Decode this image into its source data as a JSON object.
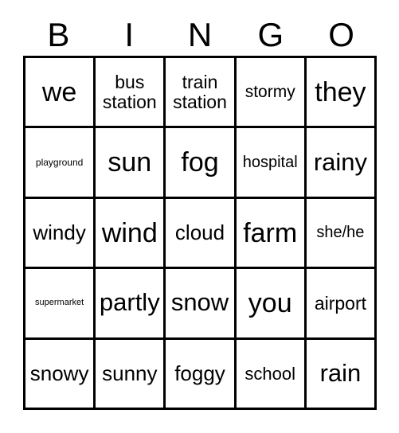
{
  "card": {
    "title": "BINGO",
    "header": {
      "letters": [
        "B",
        "I",
        "N",
        "G",
        "O"
      ]
    },
    "grid": {
      "columns": 5,
      "rows": 5,
      "border_color": "#000000",
      "background_color": "#ffffff",
      "text_color": "#000000",
      "cells": [
        [
          {
            "text": "we",
            "size": "fs-xxxl"
          },
          {
            "text": "bus station",
            "size": "fs-ll"
          },
          {
            "text": "train station",
            "size": "fs-ll"
          },
          {
            "text": "stormy",
            "size": "fs-ml"
          },
          {
            "text": "they",
            "size": "fs-xxxl"
          }
        ],
        [
          {
            "text": "playground",
            "size": "fs-s"
          },
          {
            "text": "sun",
            "size": "fs-xxxl"
          },
          {
            "text": "fog",
            "size": "fs-xxxl"
          },
          {
            "text": "hospital",
            "size": "fs-m"
          },
          {
            "text": "rainy",
            "size": "fs-xxl"
          }
        ],
        [
          {
            "text": "windy",
            "size": "fs-xl"
          },
          {
            "text": "wind",
            "size": "fs-xxxl"
          },
          {
            "text": "cloud",
            "size": "fs-xl"
          },
          {
            "text": "farm",
            "size": "fs-xxxl"
          },
          {
            "text": "she/he",
            "size": "fs-m"
          }
        ],
        [
          {
            "text": "supermarket",
            "size": "fs-xs"
          },
          {
            "text": "partly",
            "size": "fs-xxl"
          },
          {
            "text": "snow",
            "size": "fs-xxl"
          },
          {
            "text": "you",
            "size": "fs-xxxl"
          },
          {
            "text": "airport",
            "size": "fs-ll"
          }
        ],
        [
          {
            "text": "snowy",
            "size": "fs-xl"
          },
          {
            "text": "sunny",
            "size": "fs-xl"
          },
          {
            "text": "foggy",
            "size": "fs-xl"
          },
          {
            "text": "school",
            "size": "fs-l"
          },
          {
            "text": "rain",
            "size": "fs-xxl"
          }
        ]
      ]
    }
  }
}
